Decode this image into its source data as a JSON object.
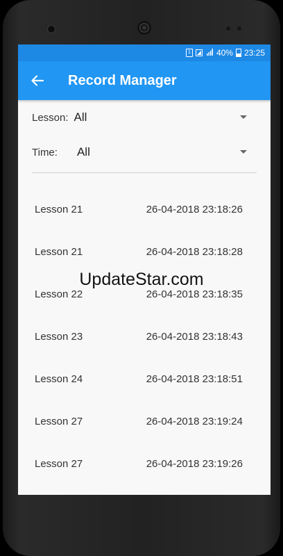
{
  "status_bar": {
    "sim_label": "1",
    "battery": "40%",
    "time": "23:25",
    "color": "#1e88e5"
  },
  "app_bar": {
    "title": "Record Manager",
    "back_icon": "arrow-left-icon",
    "color": "#2196f3"
  },
  "filters": {
    "lesson_label": "Lesson:",
    "lesson_value": "All",
    "time_label": "Time:",
    "time_value": "All"
  },
  "records": [
    {
      "lesson": "Lesson 21",
      "time": "26-04-2018 23:18:26"
    },
    {
      "lesson": "Lesson 21",
      "time": "26-04-2018 23:18:28"
    },
    {
      "lesson": "Lesson 22",
      "time": "26-04-2018 23:18:35"
    },
    {
      "lesson": "Lesson 23",
      "time": "26-04-2018 23:18:43"
    },
    {
      "lesson": "Lesson 24",
      "time": "26-04-2018 23:18:51"
    },
    {
      "lesson": "Lesson 27",
      "time": "26-04-2018 23:19:24"
    },
    {
      "lesson": "Lesson 27",
      "time": "26-04-2018 23:19:26"
    }
  ],
  "watermark": "UpdateStar.com"
}
